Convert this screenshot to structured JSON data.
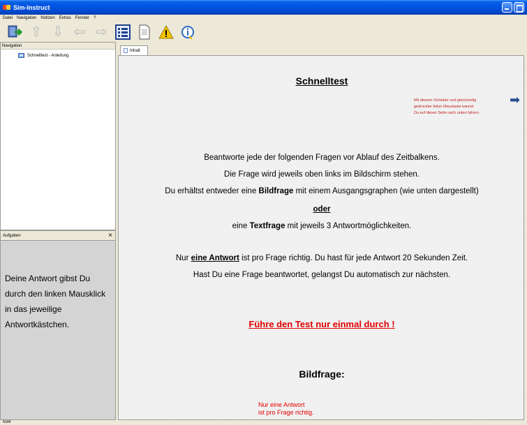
{
  "window": {
    "title": "Sim-Instruct"
  },
  "menu": [
    "Datei",
    "Navigation",
    "Notizen",
    "Extras",
    "Fenster",
    "?"
  ],
  "toolbar": {
    "icons": [
      "exit-icon",
      "arrow-up-icon",
      "arrow-down-icon",
      "arrow-left-icon",
      "arrow-right-icon",
      "list-icon",
      "page-icon",
      "warning-icon",
      "info-icon"
    ]
  },
  "navigation": {
    "header": "Navigation",
    "items": [
      {
        "label": "Schnelltest - Anleitung"
      }
    ]
  },
  "tasks": {
    "header": "Aufgaben",
    "close": "×",
    "lines": [
      "Deine Antwort gibst Du",
      "durch den linken Mausklick",
      "in das jeweilige",
      "Antwortkästchen."
    ]
  },
  "tab": {
    "label": "Inhalt"
  },
  "content": {
    "title": "Schnelltest",
    "side_note": [
      "Mit diesem Schieber und gleichzeitig",
      "gedrückter linker Maustaste kannst",
      "Du auf dieser Seite nach unten fahren."
    ],
    "p1": "Beantworte jede der folgenden Fragen vor Ablauf des Zeitbalkens.",
    "p2": "Die Frage wird jeweils oben links im Bildschirm stehen.",
    "p3_a": "Du erhältst entweder eine ",
    "p3_b": "Bildfrage",
    "p3_c": " mit einem Ausgangsgraphen (wie unten dargestellt)",
    "oder": "oder",
    "p4_a": "eine ",
    "p4_b": "Textfrage",
    "p4_c": " mit jeweils 3 Antwortmöglichkeiten.",
    "p5_a": "Nur ",
    "p5_b": "eine Antwort",
    "p5_c": " ist pro Frage richtig. Du hast für jede Antwort 20 Sekunden Zeit.",
    "p6": "Hast Du eine Frage beantwortet, gelangst Du automatisch zur nächsten.",
    "warning": "Führe den Test nur einmal durch !",
    "bildfrage": "Bildfrage:",
    "bottom_note_1": "Nur eine Antwort",
    "bottom_note_2": "ist pro Frage richtig."
  },
  "status": {
    "text": "NUM"
  }
}
